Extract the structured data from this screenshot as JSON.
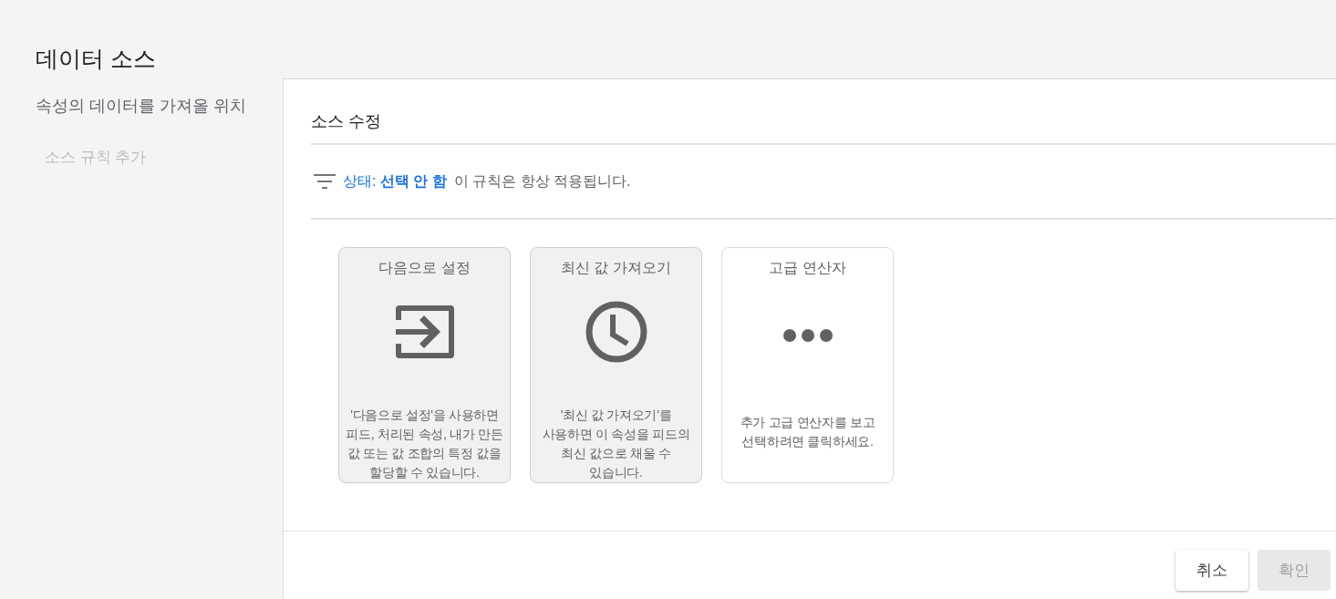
{
  "sidebar": {
    "title": "데이터 소스",
    "subtitle": "속성의 데이터를 가져올 위치",
    "items": [
      {
        "label": "소스 규칙 추가",
        "disabled": true
      }
    ]
  },
  "panel": {
    "title": "소스 수정",
    "condition": {
      "link": "상태: **선택 안 함**",
      "text": "이 규칙은 항상 적용됩니다."
    },
    "options": [
      {
        "kind": "set-to",
        "title": "다음으로 설정",
        "description": "'다음으로 설정'을 사용하면 피드, 처리된 속성, 내가 만든 값 또는 값 조합의 특정 값을 할당할 수 있습니다.",
        "disabled": true
      },
      {
        "kind": "latest",
        "title": "최신 값 가져오기",
        "description": "'최신 값 가져오기'를 사용하면 이 속성을 피드의 최신 값으로 채울 수 있습니다.",
        "disabled": true
      },
      {
        "kind": "advanced",
        "title": "고급 연산자",
        "description": "추가 고급 연산자를 보고 선택하려면 클릭하세요.",
        "disabled": false
      }
    ],
    "buttons": [
      {
        "label": "취소",
        "disabled": false
      },
      {
        "label": "확인",
        "disabled": true
      }
    ]
  }
}
